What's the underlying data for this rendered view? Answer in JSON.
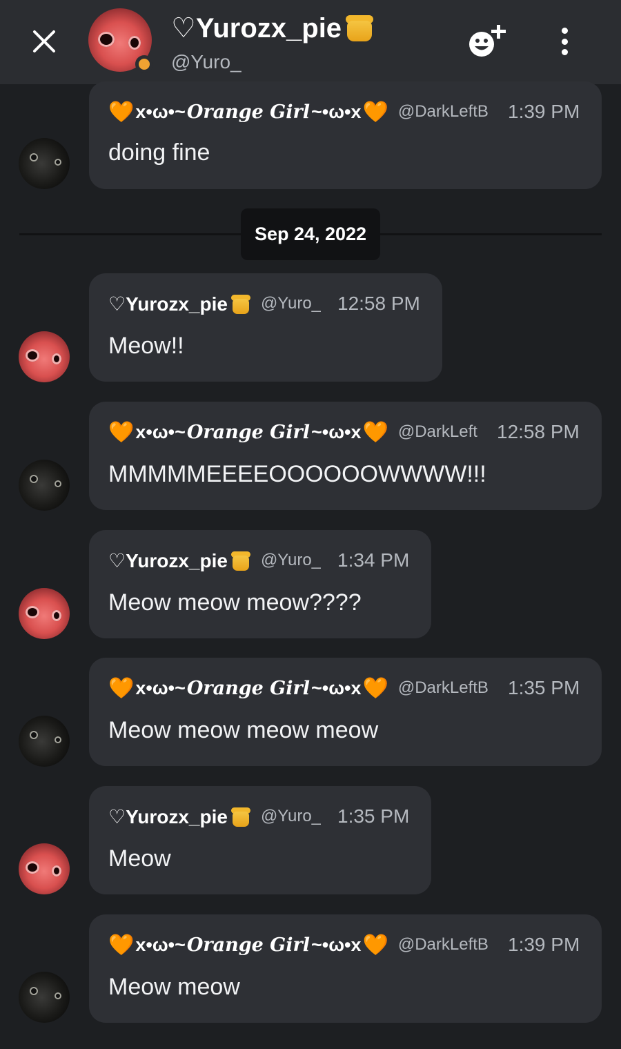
{
  "header": {
    "title": "♡Yurozx_pie",
    "handle": "@Yuro_",
    "title_emoji": "honey-pot-icon",
    "status_color": "#f0a232"
  },
  "date_separator": "Sep 24, 2022",
  "authors": {
    "yuro": {
      "name": "♡Yurozx_pie",
      "handle": "@Yuro_"
    },
    "orange": {
      "prefix": "x•ω•~",
      "fancy": "Orange Girl",
      "suffix": "~•ω•x",
      "handle_full": "@DarkLeftB",
      "handle_short": "@DarkLeft"
    }
  },
  "messages": [
    {
      "author": "orange",
      "time": "1:39 PM",
      "text": "doing fine"
    },
    {
      "author": "yuro",
      "time": "12:58 PM",
      "text": "Meow!!"
    },
    {
      "author": "orange",
      "time": "12:58 PM",
      "text": "MMMMMEEEEOOOOOOWWWW!!!"
    },
    {
      "author": "yuro",
      "time": "1:34 PM",
      "text": "Meow meow meow????"
    },
    {
      "author": "orange",
      "time": "1:35 PM",
      "text": "Meow meow meow meow"
    },
    {
      "author": "yuro",
      "time": "1:35 PM",
      "text": "Meow"
    },
    {
      "author": "orange",
      "time": "1:39 PM",
      "text": "Meow meow"
    }
  ],
  "colors": {
    "accent": "#f7941d",
    "bubble": "#2e3035",
    "background": "#1d1f22"
  }
}
